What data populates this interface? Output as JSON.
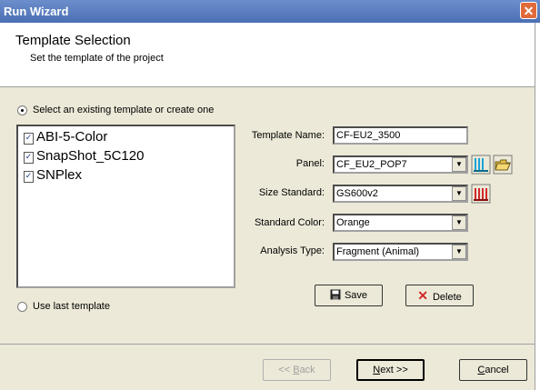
{
  "window": {
    "title": "Run Wizard"
  },
  "header": {
    "title": "Template Selection",
    "subtitle": "Set the template of the project"
  },
  "options": {
    "existing_label": "Select an existing template or create one",
    "last_label": "Use last template"
  },
  "templates": [
    "ABI-5-Color",
    "SnapShot_5C120",
    "SNPlex"
  ],
  "form": {
    "template_name_label": "Template Name:",
    "template_name_value": "CF-EU2_3500",
    "panel_label": "Panel:",
    "panel_value": "CF_EU2_POP7",
    "size_standard_label": "Size Standard:",
    "size_standard_value": "GS600v2",
    "standard_color_label": "Standard Color:",
    "standard_color_value": "Orange",
    "analysis_type_label": "Analysis Type:",
    "analysis_type_value": "Fragment (Animal)"
  },
  "buttons": {
    "save": "Save",
    "delete": "Delete",
    "back_pre": "<< ",
    "back_u": "B",
    "back_post": "ack",
    "next_u": "N",
    "next_post": "ext >>",
    "cancel_u": "C",
    "cancel_post": "ancel"
  }
}
